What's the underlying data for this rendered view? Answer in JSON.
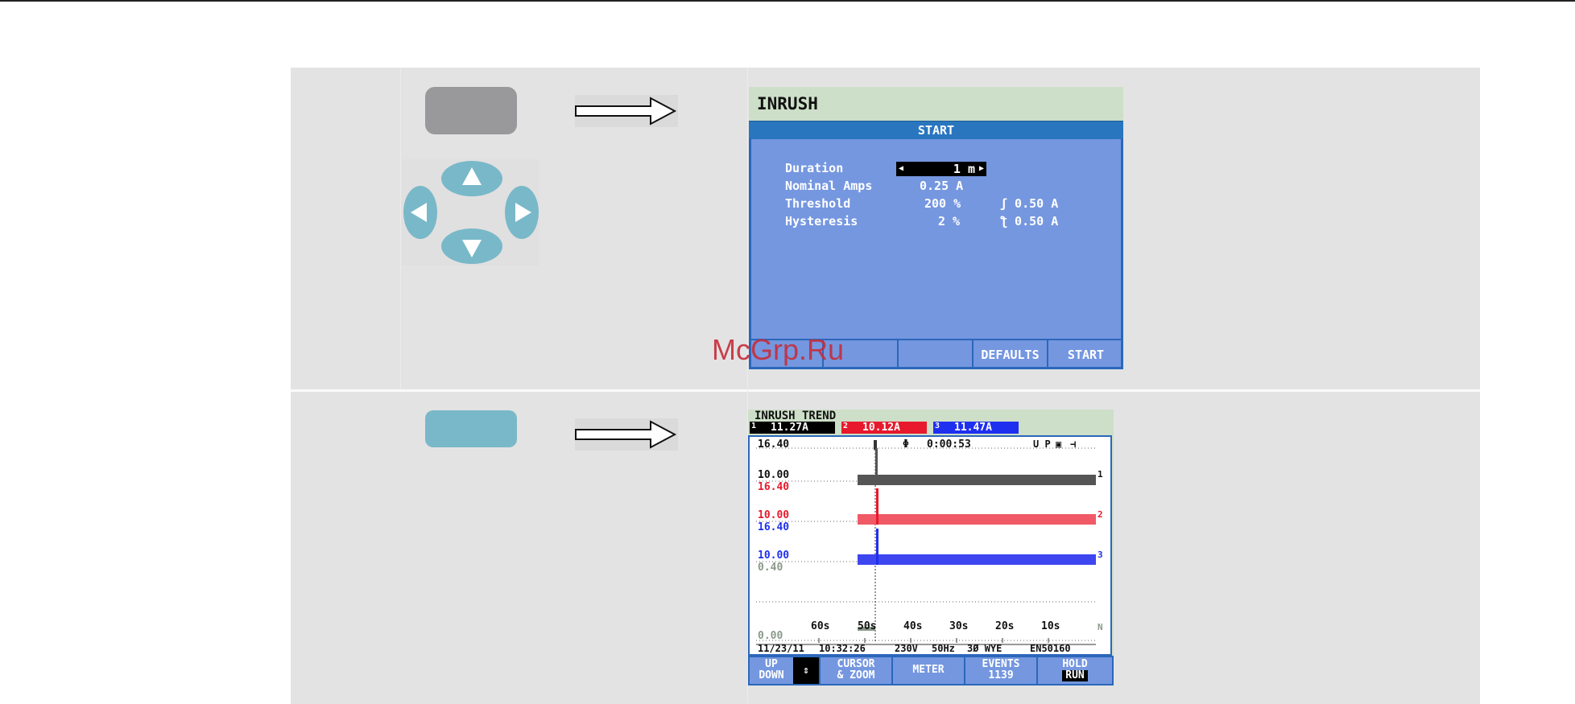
{
  "watermark": "McGrp.Ru",
  "row1": {
    "key_icon": "grey-function-key",
    "dpad_icon": "arrow-pad",
    "screen": {
      "title": "INRUSH",
      "header": "START",
      "settings": [
        {
          "label": "Duration",
          "value": "1 m"
        },
        {
          "label": "Nominal Amps",
          "value": "0.25 A"
        },
        {
          "label": "Threshold",
          "value": "200 %",
          "extra": "ʃ 0.50 A"
        },
        {
          "label": "Hysteresis",
          "value": "2 %",
          "extra": "ƪ 0.50 A"
        }
      ],
      "softkeys": [
        "",
        "",
        "",
        "DEFAULTS",
        "START"
      ]
    }
  },
  "row2": {
    "key_icon": "teal-function-key",
    "screen": {
      "title": "INRUSH TREND",
      "channels": [
        {
          "num": "1",
          "value": "11.27A",
          "color": "#000000"
        },
        {
          "num": "2",
          "value": "10.12A",
          "color": "#e8192c"
        },
        {
          "num": "3",
          "value": "11.47A",
          "color": "#1f2ff0"
        }
      ],
      "elapsed": "0:00:53",
      "status_icons": "U P",
      "tracks": [
        {
          "top": "16.40",
          "bottom": "10.00",
          "label": "1",
          "color": "#444444"
        },
        {
          "top": "16.40",
          "bottom": "10.00",
          "label": "2",
          "color": "#e8192c"
        },
        {
          "top": "16.40",
          "bottom": "10.00",
          "label": "3",
          "color": "#1f2ff0"
        },
        {
          "top": "0.40",
          "bottom": "0.00",
          "label": "N",
          "color": "#8a9a8a"
        }
      ],
      "time_ticks": [
        "60s",
        "50s",
        "40s",
        "30s",
        "20s",
        "10s"
      ],
      "status_line": {
        "date": "11/23/11",
        "time": "10:32:26",
        "voltage": "230V",
        "freq": "50Hz",
        "config": "3Ø WYE",
        "std": "EN50160"
      },
      "softkeys": [
        {
          "l1": "UP",
          "l2": "DOWN"
        },
        {
          "l1": "CURSOR",
          "l2": "& ZOOM"
        },
        {
          "l1": "METER",
          "l2": ""
        },
        {
          "l1": "EVENTS",
          "l2": "1139"
        },
        {
          "l1": "HOLD",
          "l2": "RUN"
        }
      ]
    }
  }
}
